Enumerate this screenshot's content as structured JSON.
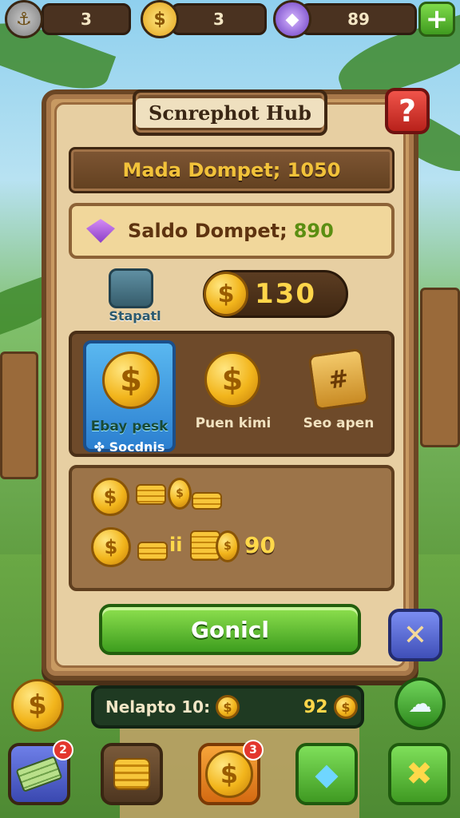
{
  "resources": [
    {
      "icon": "treasure-map-icon",
      "value": "3"
    },
    {
      "icon": "coin-bag-icon",
      "value": "3"
    },
    {
      "icon": "magic-gem-icon",
      "value": "89"
    }
  ],
  "panel": {
    "title": "Scnrephot Hub",
    "line1": "Mada Dompet; 1050",
    "line2_label": "Saldo Dompet;",
    "line2_value": "890",
    "stash_label": "Stapatl",
    "counter_value": "130",
    "options": [
      {
        "label": "Ebay pesk",
        "sub": "Socdnis",
        "selected": true
      },
      {
        "label": "Puen kimi"
      },
      {
        "label": "Seo apen"
      }
    ],
    "coins_small": "ii",
    "coins_total": "90",
    "cta_label": "Gonicl"
  },
  "info_bar": {
    "label": "Nelapto 10:",
    "value": "92"
  },
  "bottom_nav": [
    {
      "icon": "cash-stack-icon",
      "badge": "2"
    },
    {
      "icon": "coin-stack-icon"
    },
    {
      "icon": "gold-coin-icon",
      "badge": "3"
    },
    {
      "icon": "speech-bubble-icon"
    },
    {
      "icon": "close-x-icon"
    }
  ],
  "colors": {
    "gold": "#ffd64a",
    "green": "#3d9d1e",
    "wood": "#6b4624",
    "red": "#e3372d"
  }
}
